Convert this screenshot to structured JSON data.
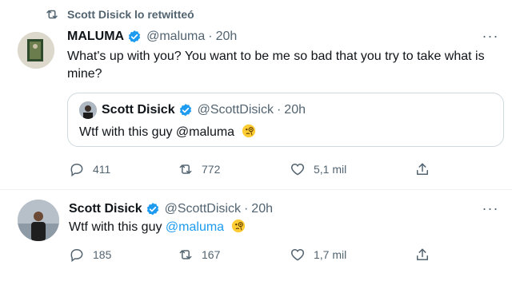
{
  "retweet_banner": {
    "icon": "retweet-icon",
    "text": "Scott Disick lo retwitteó"
  },
  "tweet_main": {
    "author_name": "MALUMA",
    "verified_icon": "verified-badge-icon",
    "handle": "@maluma",
    "time": "20h",
    "more_icon": "more-options-icon",
    "text": "What's up with you? You want to be me so bad that you try to take what is mine?",
    "quote": {
      "author_name": "Scott Disick",
      "handle": "@ScottDisick",
      "time": "20h",
      "text_prefix": "Wtf with this guy @maluma",
      "emoji": "face-with-monocle-emoji"
    },
    "actions": {
      "replies": "411",
      "retweets": "772",
      "likes": "5,1 mil"
    }
  },
  "tweet_second": {
    "author_name": "Scott Disick",
    "verified_icon": "verified-badge-icon",
    "handle": "@ScottDisick",
    "time": "20h",
    "more_icon": "more-options-icon",
    "text_prefix": "Wtf with this guy ",
    "mention": "@maluma",
    "emoji": "face-with-monocle-emoji",
    "actions": {
      "replies": "185",
      "retweets": "167",
      "likes": "1,7 mil"
    }
  },
  "colors": {
    "accent": "#1d9bf0",
    "secondary_text": "#536471",
    "border": "#cfd9de"
  }
}
